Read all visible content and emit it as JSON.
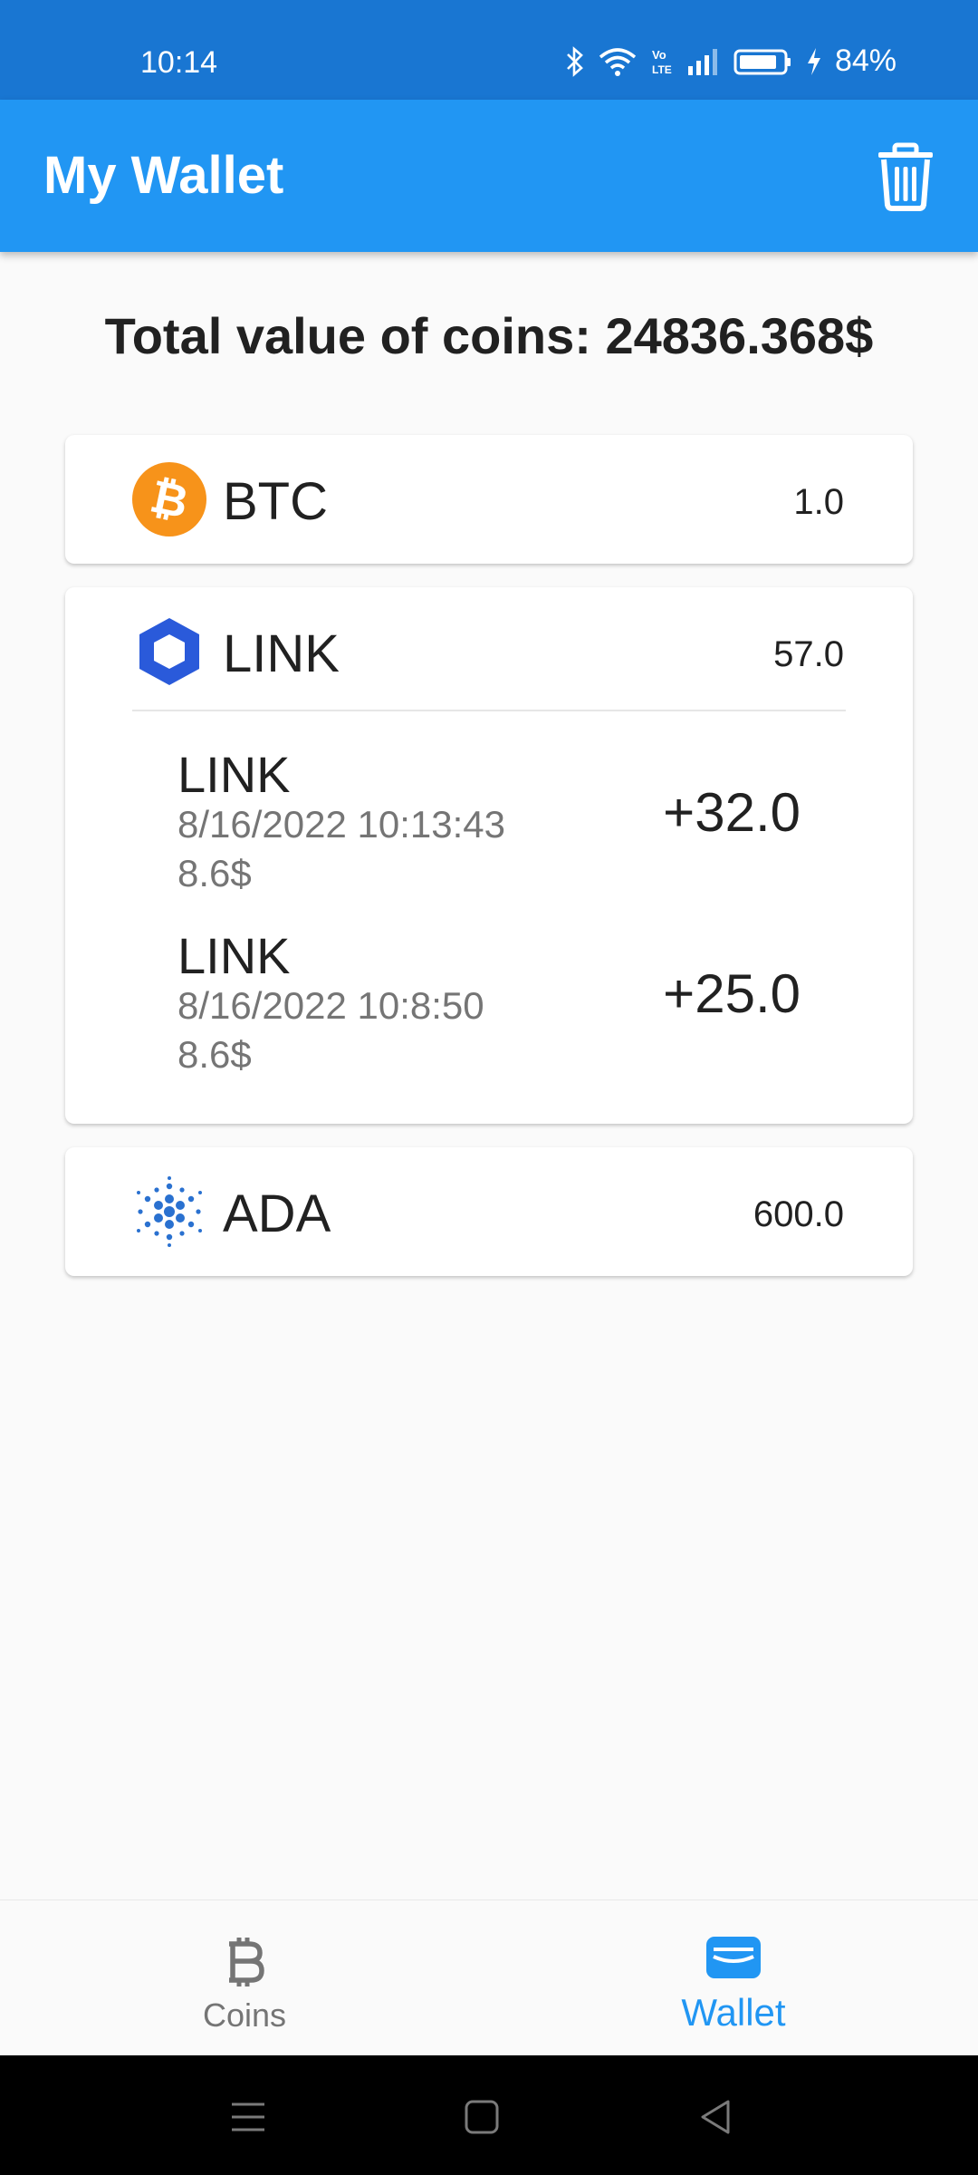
{
  "status_bar": {
    "time": "10:14",
    "battery": "84%"
  },
  "app_bar": {
    "title": "My Wallet",
    "trash_icon": "trash-icon"
  },
  "total": {
    "label": "Total value of coins: 24836.368$"
  },
  "coins": [
    {
      "symbol": "BTC",
      "amount": "1.0",
      "icon": "bitcoin-icon",
      "color": "#f7931a"
    },
    {
      "symbol": "LINK",
      "amount": "57.0",
      "icon": "chainlink-icon",
      "color": "#2a5ada",
      "transactions": [
        {
          "name": "LINK",
          "date": "8/16/2022 10:13:43",
          "price": "8.6$",
          "change": "+32.0"
        },
        {
          "name": "LINK",
          "date": "8/16/2022 10:8:50",
          "price": "8.6$",
          "change": "+25.0"
        }
      ]
    },
    {
      "symbol": "ADA",
      "amount": "600.0",
      "icon": "cardano-icon",
      "color": "#2a71d0"
    }
  ],
  "bottom_nav": {
    "items": [
      {
        "label": "Coins",
        "icon": "bitcoin-symbol-icon",
        "active": false
      },
      {
        "label": "Wallet",
        "icon": "wallet-icon",
        "active": true
      }
    ]
  },
  "colors": {
    "primary": "#2196f3",
    "status_bar": "#1976d2",
    "inactive": "#757575"
  }
}
